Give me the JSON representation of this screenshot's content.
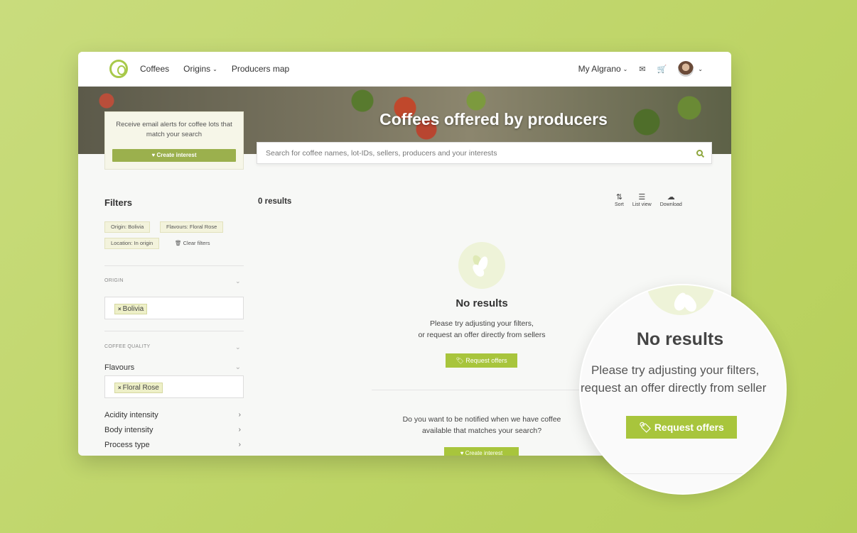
{
  "nav": {
    "links": [
      "Coffees",
      "Origins",
      "Producers map"
    ],
    "my_account": "My Algrano"
  },
  "hero": {
    "title": "Coffees offered by producers"
  },
  "alert": {
    "text": "Receive email alerts for coffee lots that match your search",
    "button": "♥ Create interest"
  },
  "search": {
    "placeholder": "Search for coffee names, lot-IDs, sellers, producers and your interests"
  },
  "filters": {
    "title": "Filters",
    "chips": [
      "Origin: Bolivia",
      "Flavours: Floral Rose",
      "Location: In origin"
    ],
    "clear": "🗑 Clear filters",
    "origin_label": "ORIGIN",
    "origin_tag": "Bolivia",
    "quality_label": "COFFEE QUALITY",
    "flavours_label": "Flavours",
    "flavour_tag": "Floral Rose",
    "rows": [
      "Acidity intensity",
      "Body intensity",
      "Process type"
    ]
  },
  "results": {
    "count": "0 results",
    "tools": [
      "Sort",
      "List view",
      "Download"
    ],
    "no_results": "No results",
    "msg_line1": "Please try adjusting your filters,",
    "msg_line2": "or request an offer directly from sellers",
    "request_button": "Request offers",
    "notify_line1": "Do you want to be notified when we have coffee",
    "notify_line2": "available that matches your search?",
    "create_button": "♥ Create interest"
  },
  "magnifier": {
    "title": "No results",
    "line1": "Please try adjusting your filters,",
    "line2": "request an offer directly from seller",
    "button": "Request offers"
  },
  "colors": {
    "accent": "#a8c53c",
    "background": "#c3d86f"
  }
}
